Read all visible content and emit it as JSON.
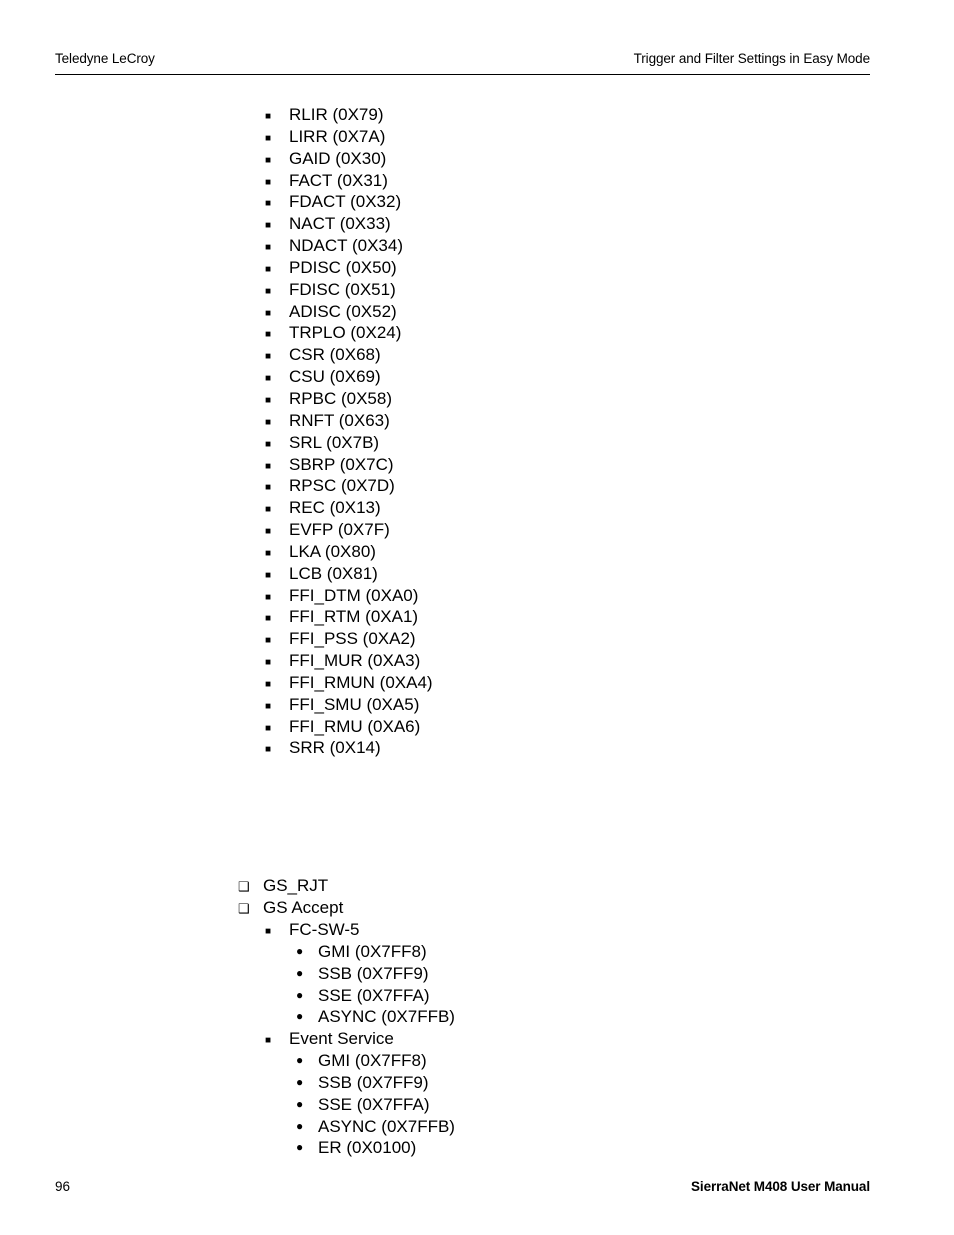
{
  "header": {
    "left": "Teledyne LeCroy",
    "right": "Trigger and Filter Settings in Easy Mode"
  },
  "footer": {
    "page_number": "96",
    "manual_title": "SierraNet M408 User Manual"
  },
  "markers": {
    "filled_square": "■",
    "hollow_square": "❑",
    "filled_circle": "●"
  },
  "section_one": {
    "items": [
      {
        "level": 2,
        "marker": "filled_square",
        "label": "RLIR (0X79)"
      },
      {
        "level": 2,
        "marker": "filled_square",
        "label": "LIRR (0X7A)"
      },
      {
        "level": 2,
        "marker": "filled_square",
        "label": "GAID (0X30)"
      },
      {
        "level": 2,
        "marker": "filled_square",
        "label": "FACT (0X31)"
      },
      {
        "level": 2,
        "marker": "filled_square",
        "label": "FDACT (0X32)"
      },
      {
        "level": 2,
        "marker": "filled_square",
        "label": "NACT (0X33)"
      },
      {
        "level": 2,
        "marker": "filled_square",
        "label": "NDACT (0X34)"
      },
      {
        "level": 2,
        "marker": "filled_square",
        "label": "PDISC (0X50)"
      },
      {
        "level": 2,
        "marker": "filled_square",
        "label": "FDISC (0X51)"
      },
      {
        "level": 2,
        "marker": "filled_square",
        "label": "ADISC (0X52)"
      },
      {
        "level": 2,
        "marker": "filled_square",
        "label": "TRPLO (0X24)"
      },
      {
        "level": 2,
        "marker": "filled_square",
        "label": "CSR (0X68)"
      },
      {
        "level": 2,
        "marker": "filled_square",
        "label": "CSU (0X69)"
      },
      {
        "level": 2,
        "marker": "filled_square",
        "label": "RPBC (0X58)"
      },
      {
        "level": 2,
        "marker": "filled_square",
        "label": "RNFT (0X63)"
      },
      {
        "level": 2,
        "marker": "filled_square",
        "label": "SRL (0X7B)"
      },
      {
        "level": 2,
        "marker": "filled_square",
        "label": "SBRP (0X7C)"
      },
      {
        "level": 2,
        "marker": "filled_square",
        "label": "RPSC (0X7D)"
      },
      {
        "level": 2,
        "marker": "filled_square",
        "label": "REC (0X13)"
      },
      {
        "level": 2,
        "marker": "filled_square",
        "label": "EVFP (0X7F)"
      },
      {
        "level": 2,
        "marker": "filled_square",
        "label": "LKA (0X80)"
      },
      {
        "level": 2,
        "marker": "filled_square",
        "label": "LCB (0X81)"
      },
      {
        "level": 2,
        "marker": "filled_square",
        "label": "FFI_DTM (0XA0)"
      },
      {
        "level": 2,
        "marker": "filled_square",
        "label": "FFI_RTM (0XA1)"
      },
      {
        "level": 2,
        "marker": "filled_square",
        "label": "FFI_PSS (0XA2)"
      },
      {
        "level": 2,
        "marker": "filled_square",
        "label": "FFI_MUR (0XA3)"
      },
      {
        "level": 2,
        "marker": "filled_square",
        "label": "FFI_RMUN (0XA4)"
      },
      {
        "level": 2,
        "marker": "filled_square",
        "label": "FFI_SMU (0XA5)"
      },
      {
        "level": 2,
        "marker": "filled_square",
        "label": "FFI_RMU (0XA6)"
      },
      {
        "level": 2,
        "marker": "filled_square",
        "label": "SRR (0X14)"
      }
    ]
  },
  "section_two": {
    "items": [
      {
        "level": 1,
        "marker": "hollow_square",
        "label": "GS_RJT"
      },
      {
        "level": 1,
        "marker": "hollow_square",
        "label": "GS Accept"
      },
      {
        "level": 2,
        "marker": "filled_square",
        "label": "FC-SW-5"
      },
      {
        "level": 3,
        "marker": "filled_circle",
        "label": "GMI (0X7FF8)"
      },
      {
        "level": 3,
        "marker": "filled_circle",
        "label": "SSB (0X7FF9)"
      },
      {
        "level": 3,
        "marker": "filled_circle",
        "label": "SSE (0X7FFA)"
      },
      {
        "level": 3,
        "marker": "filled_circle",
        "label": "ASYNC (0X7FFB)"
      },
      {
        "level": 2,
        "marker": "filled_square",
        "label": "Event Service"
      },
      {
        "level": 3,
        "marker": "filled_circle",
        "label": "GMI (0X7FF8)"
      },
      {
        "level": 3,
        "marker": "filled_circle",
        "label": "SSB (0X7FF9)"
      },
      {
        "level": 3,
        "marker": "filled_circle",
        "label": "SSE (0X7FFA)"
      },
      {
        "level": 3,
        "marker": "filled_circle",
        "label": "ASYNC (0X7FFB)"
      },
      {
        "level": 3,
        "marker": "filled_circle",
        "label": "ER (0X0100)"
      }
    ]
  }
}
